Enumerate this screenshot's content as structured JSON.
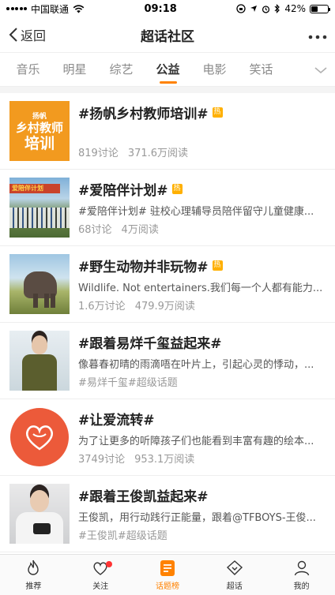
{
  "status_bar": {
    "carrier": "中国联通",
    "time": "09:18",
    "battery": "42%",
    "battery_level": 0.42
  },
  "navbar": {
    "back_label": "返回",
    "title": "超话社区",
    "more_icon": "more-horizontal-icon"
  },
  "tabs": [
    {
      "label": "音乐"
    },
    {
      "label": "明星"
    },
    {
      "label": "综艺"
    },
    {
      "label": "公益",
      "active": true
    },
    {
      "label": "电影"
    },
    {
      "label": "笑话"
    }
  ],
  "items": [
    {
      "title": "#扬帆乡村教师培训#",
      "hot": "热",
      "thumb_text": {
        "small": "扬帆",
        "line1": "乡村教师",
        "line2": "培训"
      },
      "meta": [
        "819讨论",
        "371.6万阅读"
      ]
    },
    {
      "title": "#爱陪伴计划#",
      "hot": "热",
      "thumb_text": "爱陪伴计划",
      "desc": "#爱陪伴计划# 驻校心理辅导员陪伴留守儿童健康...",
      "meta": [
        "68讨论",
        "4万阅读"
      ]
    },
    {
      "title": "#野生动物并非玩物#",
      "hot": "热",
      "desc": "Wildlife. Not entertainers.我们每一个人都有能力...",
      "meta": [
        "1.6万讨论",
        "479.9万阅读"
      ]
    },
    {
      "title": "#跟着易烊千玺益起来#",
      "desc": "像暮春初晴的雨滴唔在叶片上，引起心灵的悸动，...",
      "meta": [
        "#易烊千玺#超级话题"
      ]
    },
    {
      "title": "#让爱流转#",
      "desc": "为了让更多的听障孩子们也能看到丰富有趣的绘本...",
      "meta": [
        "3749讨论",
        "953.1万阅读"
      ]
    },
    {
      "title": "#跟着王俊凯益起来#",
      "desc": "王俊凯，用行动践行正能量，跟着@TFBOYS-王俊...",
      "meta": [
        "#王俊凯#超级话题"
      ]
    }
  ],
  "tabbar": [
    {
      "label": "推荐",
      "icon": "flame-icon"
    },
    {
      "label": "关注",
      "icon": "heart-icon",
      "badge": true
    },
    {
      "label": "话题榜",
      "icon": "topic-list-icon",
      "active": true
    },
    {
      "label": "超话",
      "icon": "diamond-icon"
    },
    {
      "label": "我的",
      "icon": "person-icon"
    }
  ],
  "colors": {
    "accent": "#ff8200",
    "hot_badge": "#ffb000",
    "badge_dot": "#ff3333"
  }
}
